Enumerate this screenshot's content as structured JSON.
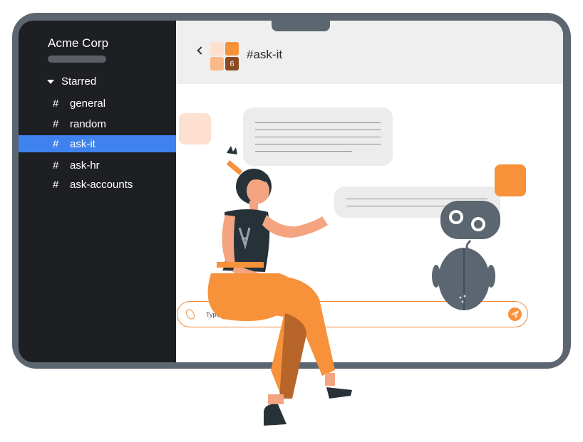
{
  "sidebar": {
    "workspace": "Acme Corp",
    "section": "Starred",
    "channels": [
      {
        "hash": "#",
        "name": "general"
      },
      {
        "hash": "#",
        "name": "random"
      },
      {
        "hash": "#",
        "name": "ask-it"
      },
      {
        "hash": "#",
        "name": "ask-hr"
      },
      {
        "hash": "#",
        "name": "ask-accounts"
      }
    ]
  },
  "header": {
    "channel": "#ask-it",
    "badge": "6"
  },
  "composer": {
    "placeholder": "Type a message..."
  },
  "colors": {
    "accent": "#3f82ee",
    "brand_orange": "#f7913a",
    "sidebar_bg": "#1e1f23",
    "frame": "#5b6670"
  }
}
